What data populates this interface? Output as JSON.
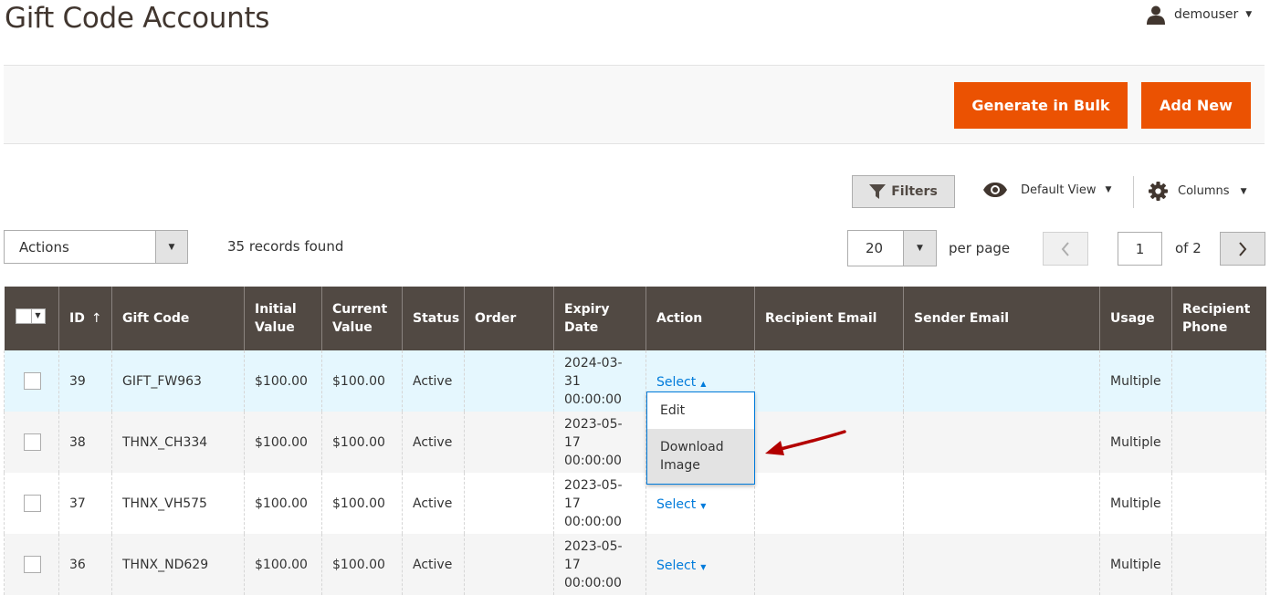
{
  "page": {
    "title": "Gift Code Accounts"
  },
  "user": {
    "name": "demouser"
  },
  "toolbar": {
    "generate_bulk": "Generate in Bulk",
    "add_new": "Add New"
  },
  "grid_controls": {
    "filters": "Filters",
    "view": "Default View",
    "columns": "Columns",
    "actions": "Actions",
    "records": "35 records found",
    "per_page_value": "20",
    "per_page_label": "per page",
    "page_current": "1",
    "page_of": "of 2"
  },
  "table": {
    "headers": [
      "ID",
      "Gift Code",
      "Initial Value",
      "Current Value",
      "Status",
      "Order",
      "Expiry Date",
      "Action",
      "Recipient Email",
      "Sender Email",
      "Usage",
      "Recipient Phone"
    ],
    "rows": [
      {
        "id": "39",
        "code": "GIFT_FW963",
        "initial": "$100.00",
        "current": "$100.00",
        "status": "Active",
        "order": "",
        "expiry_date": "2024-03-31",
        "expiry_time": "00:00:00",
        "action": "Select",
        "recipient_email": "",
        "sender_email": "",
        "usage": "Multiple",
        "recipient_phone": ""
      },
      {
        "id": "38",
        "code": "THNX_CH334",
        "initial": "$100.00",
        "current": "$100.00",
        "status": "Active",
        "order": "",
        "expiry_date": "2023-05-17",
        "expiry_time": "00:00:00",
        "action": "",
        "recipient_email": "",
        "sender_email": "",
        "usage": "Multiple",
        "recipient_phone": ""
      },
      {
        "id": "37",
        "code": "THNX_VH575",
        "initial": "$100.00",
        "current": "$100.00",
        "status": "Active",
        "order": "",
        "expiry_date": "2023-05-17",
        "expiry_time": "00:00:00",
        "action": "Select",
        "recipient_email": "",
        "sender_email": "",
        "usage": "Multiple",
        "recipient_phone": ""
      },
      {
        "id": "36",
        "code": "THNX_ND629",
        "initial": "$100.00",
        "current": "$100.00",
        "status": "Active",
        "order": "",
        "expiry_date": "2023-05-17",
        "expiry_time": "00:00:00",
        "action": "Select",
        "recipient_email": "",
        "sender_email": "",
        "usage": "Multiple",
        "recipient_phone": ""
      }
    ]
  },
  "action_menu": {
    "items": [
      "Edit",
      "Download Image"
    ]
  },
  "icons": {
    "user": "user-icon",
    "filter": "filter-icon",
    "view": "eye-icon",
    "columns": "gear-icon",
    "prev": "chevron-left-icon",
    "next": "chevron-right-icon",
    "annotation": "red-arrow-icon"
  },
  "colors": {
    "primary": "#eb5202",
    "header_bg": "#514943",
    "link": "#007bdb",
    "active_row": "#e5f7fe",
    "annotation": "#b30000"
  }
}
